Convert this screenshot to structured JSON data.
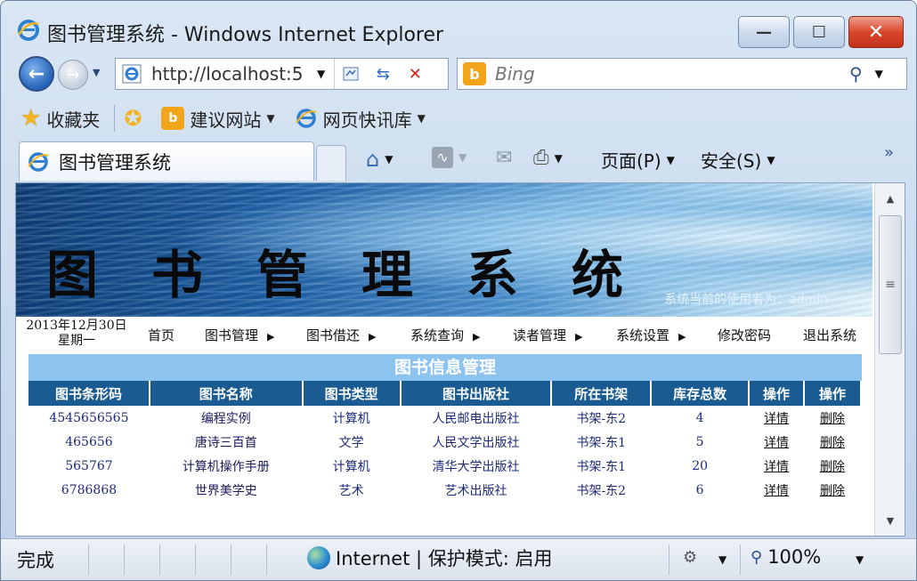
{
  "window": {
    "title": "图书管理系统 - Windows Internet Explorer",
    "min_glyph": "—",
    "max_glyph": "☐",
    "close_glyph": "✕"
  },
  "toolbar": {
    "address": "http://localhost:5",
    "search_placeholder": "Bing",
    "search_logo": "b"
  },
  "favorites": {
    "label": "收藏夹",
    "items": [
      "建议网站",
      "网页快讯库"
    ]
  },
  "tabs": [
    {
      "label": "图书管理系统"
    }
  ],
  "commands": {
    "page": "页面(P)",
    "safety": "安全(S)"
  },
  "site": {
    "banner_title": "图书管理系统",
    "current_user": "系统当前的使用者为：admin",
    "date": "2013年12月30日",
    "weekday": "星期一",
    "menu": [
      {
        "label": "首页",
        "has_submenu": false
      },
      {
        "label": "图书管理",
        "has_submenu": true
      },
      {
        "label": "图书借还",
        "has_submenu": true
      },
      {
        "label": "系统查询",
        "has_submenu": true
      },
      {
        "label": "读者管理",
        "has_submenu": true
      },
      {
        "label": "系统设置",
        "has_submenu": true
      },
      {
        "label": "修改密码",
        "has_submenu": false
      },
      {
        "label": "退出系统",
        "has_submenu": false
      }
    ]
  },
  "book_panel": {
    "title": "图书信息管理",
    "columns": [
      "图书条形码",
      "图书名称",
      "图书类型",
      "图书出版社",
      "所在书架",
      "库存总数",
      "操作",
      "操作"
    ],
    "rows": [
      {
        "barcode": "4545656565",
        "name": "编程实例",
        "type": "计算机",
        "publisher": "人民邮电出版社",
        "shelf": "书架-东2",
        "stock": "4",
        "detail": "详情",
        "delete": "删除"
      },
      {
        "barcode": "465656",
        "name": "唐诗三百首",
        "type": "文学",
        "publisher": "人民文学出版社",
        "shelf": "书架-东1",
        "stock": "5",
        "detail": "详情",
        "delete": "删除"
      },
      {
        "barcode": "565767",
        "name": "计算机操作手册",
        "type": "计算机",
        "publisher": "清华大学出版社",
        "shelf": "书架-东1",
        "stock": "20",
        "detail": "详情",
        "delete": "删除"
      },
      {
        "barcode": "6786868",
        "name": "世界美学史",
        "type": "艺术",
        "publisher": "艺术出版社",
        "shelf": "书架-东2",
        "stock": "6",
        "detail": "详情",
        "delete": "删除"
      }
    ]
  },
  "status": {
    "text": "完成",
    "zone": "Internet | 保护模式: 启用",
    "zoom": "100%"
  }
}
